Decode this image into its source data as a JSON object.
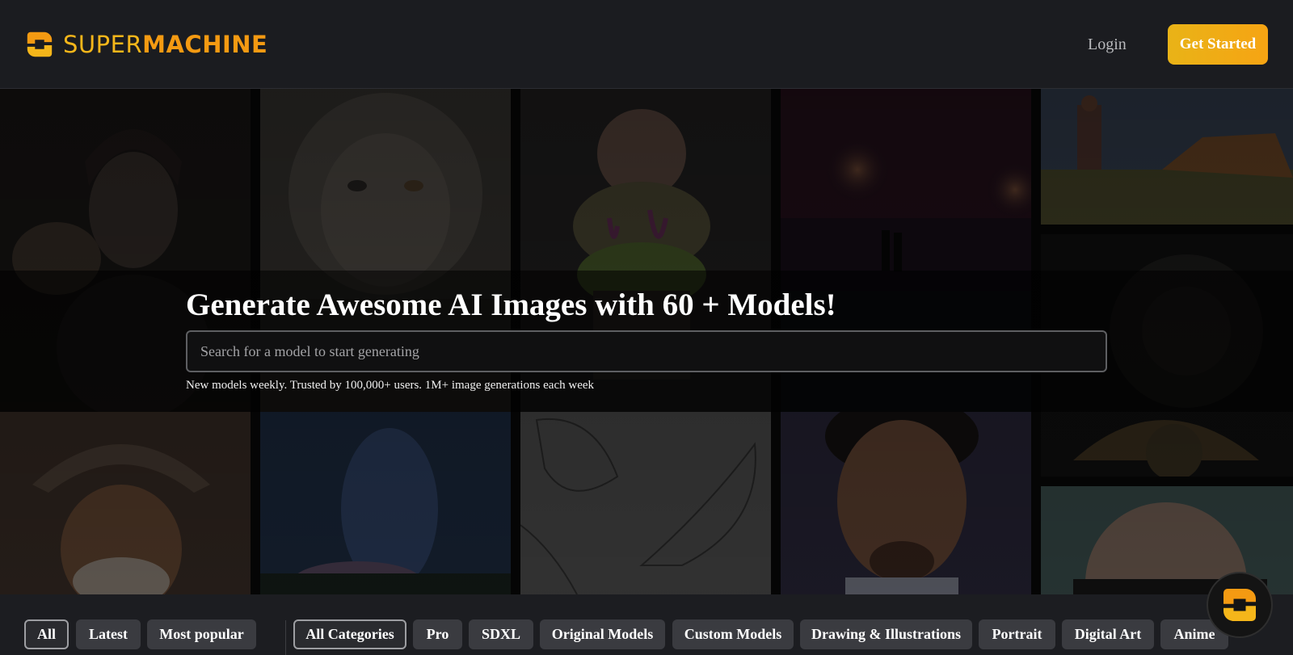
{
  "brand": {
    "name_part1": "SUPER",
    "name_part2": "MACHINE"
  },
  "nav": {
    "login": "Login",
    "get_started": "Get Started"
  },
  "hero": {
    "title": "Generate Awesome AI Images with 60 + Models!",
    "search_placeholder": "Search for a model to start generating",
    "subtitle": "New models weekly. Trusted by 100,000+ users. 1M+ image generations each week"
  },
  "filters": {
    "sort": [
      "All",
      "Latest",
      "Most popular"
    ],
    "categories": [
      "All Categories",
      "Pro",
      "SDXL",
      "Original Models",
      "Custom Models",
      "Drawing & Illustrations",
      "Portrait",
      "Digital Art",
      "Anime"
    ]
  },
  "colors": {
    "brand_yellow": "#f5b61a",
    "brand_orange": "#f49a12",
    "background": "#1b1c20"
  },
  "icons": {
    "logo": "supermachine-logo-icon",
    "chat": "chat-widget-icon"
  }
}
